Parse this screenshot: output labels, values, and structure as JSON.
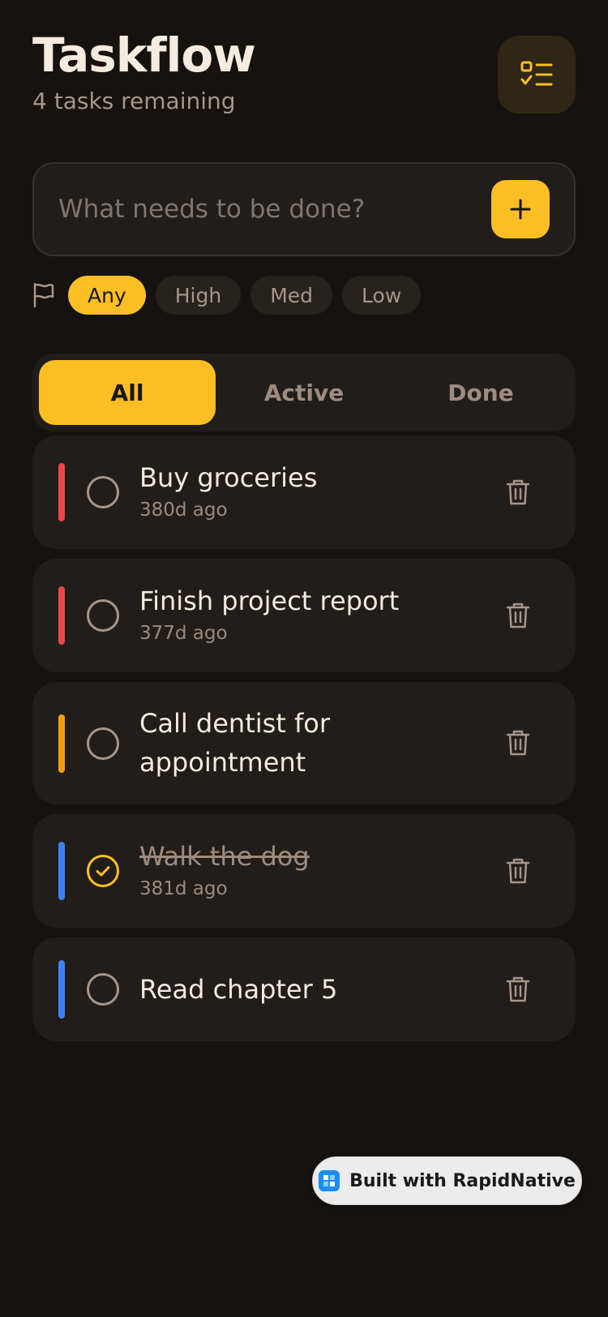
{
  "header": {
    "title": "Taskflow",
    "subtitle": "4 tasks remaining"
  },
  "input": {
    "placeholder": "What needs to be done?",
    "value": ""
  },
  "priority_filter": {
    "options": [
      "Any",
      "High",
      "Med",
      "Low"
    ],
    "selected": "Any"
  },
  "tabs": {
    "items": [
      "All",
      "Active",
      "Done"
    ],
    "selected": "All"
  },
  "tasks": [
    {
      "title": "Buy groceries",
      "time": "380d ago",
      "priority_color": "#ef4444",
      "done": false
    },
    {
      "title": "Finish project report",
      "time": "377d ago",
      "priority_color": "#ef4444",
      "done": false
    },
    {
      "title": "Call dentist for appointment",
      "time": "",
      "priority_color": "#f59e0b",
      "done": false
    },
    {
      "title": "Walk the dog",
      "time": "381d ago",
      "priority_color": "#3b82f6",
      "done": true
    },
    {
      "title": "Read chapter 5",
      "time": "",
      "priority_color": "#3b82f6",
      "done": false
    }
  ],
  "badge": {
    "label": "Built with RapidNative"
  },
  "colors": {
    "accent": "#fbbf24",
    "background": "#15120f",
    "card": "#211d1a",
    "muted_text": "#a6968a"
  },
  "icons": {
    "header": "checklist-icon",
    "add": "plus-icon",
    "filter": "flag-icon",
    "check": "circle-icon",
    "checked": "check-circle-icon",
    "delete": "trash-icon"
  }
}
